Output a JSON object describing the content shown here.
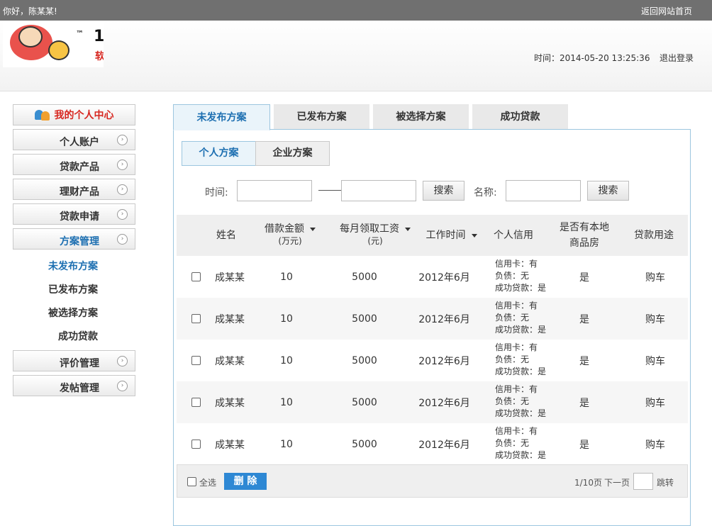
{
  "topbar": {
    "greeting": "你好，陈某某!",
    "home_link": "返回网站首页"
  },
  "header": {
    "logo": {
      "tm": "™",
      "glyph1": "1",
      "glyph2": "软"
    },
    "time": "时间：2014-05-20 13:25:36",
    "logout": "退出登录"
  },
  "sidebar": {
    "title": "我的个人中心",
    "items": [
      {
        "label": "个人账户"
      },
      {
        "label": "贷款产品"
      },
      {
        "label": "理财产品"
      },
      {
        "label": "贷款申请"
      },
      {
        "label": "方案管理"
      }
    ],
    "arrow": "›",
    "subitems": [
      {
        "label": "未发布方案"
      },
      {
        "label": "已发布方案"
      },
      {
        "label": "被选择方案"
      },
      {
        "label": "成功贷款"
      }
    ],
    "items_after": [
      {
        "label": "评价管理"
      },
      {
        "label": "发帖管理"
      }
    ]
  },
  "main_tabs": [
    {
      "label": "未发布方案"
    },
    {
      "label": "已发布方案"
    },
    {
      "label": "被选择方案"
    },
    {
      "label": "成功贷款"
    }
  ],
  "sub_tabs": [
    {
      "label": "个人方案"
    },
    {
      "label": "企业方案"
    }
  ],
  "search": {
    "time_label": "时间:",
    "name_label": "名称:",
    "button": "搜索",
    "start_value": "",
    "end_value": "",
    "name_value": ""
  },
  "table": {
    "headers": {
      "name": "姓名",
      "amount": "借款金额",
      "amount_unit": "(万元)",
      "salary": "每月领取工资",
      "salary_unit": "(元)",
      "work_time": "工作时间",
      "credit": "个人信用",
      "house_line1": "是否有本地",
      "house_line2": "商品房",
      "purpose": "贷款用途"
    },
    "rows": [
      {
        "name": "成某某",
        "amount": "10",
        "salary": "5000",
        "work_time": "2012年6月",
        "credit_card": "信用卡：有",
        "debt": "负债：无",
        "success": "成功贷款：是",
        "house": "是",
        "purpose": "购车"
      },
      {
        "name": "成某某",
        "amount": "10",
        "salary": "5000",
        "work_time": "2012年6月",
        "credit_card": "信用卡：有",
        "debt": "负债：无",
        "success": "成功贷款：是",
        "house": "是",
        "purpose": "购车"
      },
      {
        "name": "成某某",
        "amount": "10",
        "salary": "5000",
        "work_time": "2012年6月",
        "credit_card": "信用卡：有",
        "debt": "负债：无",
        "success": "成功贷款：是",
        "house": "是",
        "purpose": "购车"
      },
      {
        "name": "成某某",
        "amount": "10",
        "salary": "5000",
        "work_time": "2012年6月",
        "credit_card": "信用卡：有",
        "debt": "负债：无",
        "success": "成功贷款：是",
        "house": "是",
        "purpose": "购车"
      },
      {
        "name": "成某某",
        "amount": "10",
        "salary": "5000",
        "work_time": "2012年6月",
        "credit_card": "信用卡：有",
        "debt": "负债：无",
        "success": "成功贷款：是",
        "house": "是",
        "purpose": "购车"
      }
    ]
  },
  "footer": {
    "select_all": "全选",
    "delete": "删 除",
    "page": "1/10页",
    "next": "下一页",
    "jump": "跳转",
    "jump_value": ""
  }
}
